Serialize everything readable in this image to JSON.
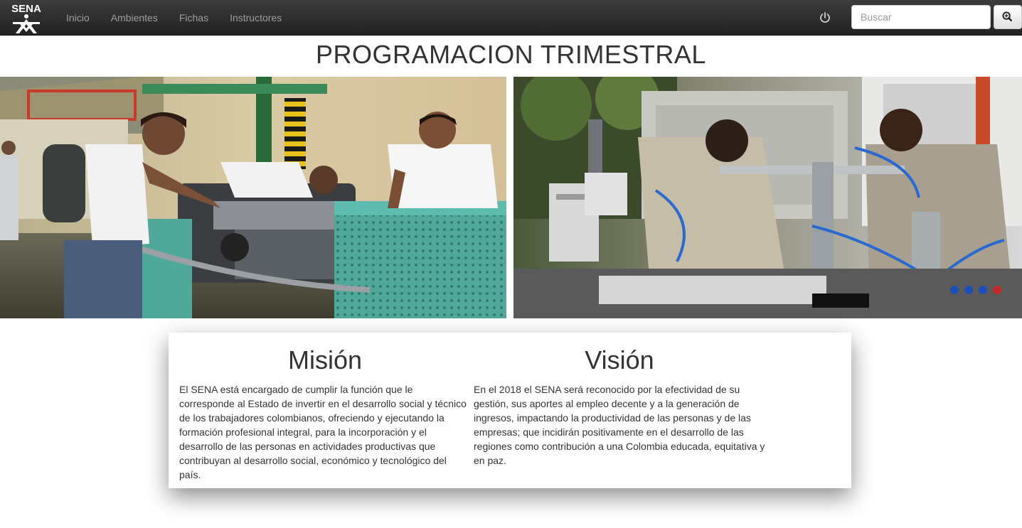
{
  "navbar": {
    "brand": "SENA",
    "links": [
      "Inicio",
      "Ambientes",
      "Fichas",
      "Instructores"
    ],
    "search_placeholder": "Buscar",
    "icons": {
      "power": "power-icon",
      "search": "zoom-in-icon"
    }
  },
  "page": {
    "title": "PROGRAMACION TRIMESTRAL"
  },
  "hero_images": [
    {
      "name": "hero-image-engine-workshop"
    },
    {
      "name": "hero-image-automation-lab"
    }
  ],
  "mission": {
    "heading": "Misión",
    "text": "El SENA está encargado de cumplir la función que le corresponde al Estado de invertir en el desarrollo social y técnico de los trabajadores colombianos, ofreciendo y ejecutando la formación profesional integral, para la incorporación y el desarrollo de las personas en actividades productivas que contribuyan al desarrollo social, económico y tecnológico del país."
  },
  "vision": {
    "heading": "Visión",
    "text": "En el 2018 el SENA será reconocido por la efectividad de su gestión, sus aportes al empleo decente y a la generación de ingresos, impactando la productividad de las personas y de las empresas; que incidirán positivamente en el desarrollo de las regiones como contribución a una Colombia educada, equitativa y en paz."
  },
  "colors": {
    "navbar_bg": "#222222",
    "nav_link": "#9d9d9d",
    "text": "#333333",
    "brand": "#ffffff"
  }
}
